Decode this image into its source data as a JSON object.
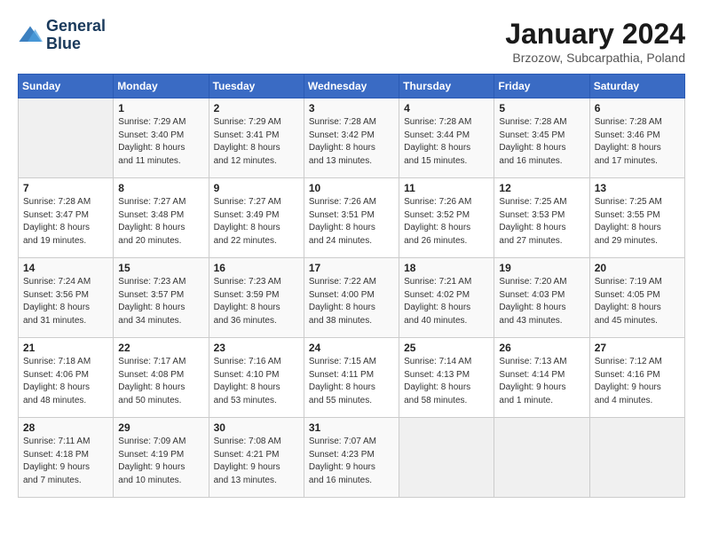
{
  "header": {
    "logo_line1": "General",
    "logo_line2": "Blue",
    "month_title": "January 2024",
    "subtitle": "Brzozow, Subcarpathia, Poland"
  },
  "weekdays": [
    "Sunday",
    "Monday",
    "Tuesday",
    "Wednesday",
    "Thursday",
    "Friday",
    "Saturday"
  ],
  "weeks": [
    [
      {
        "day": "",
        "info": ""
      },
      {
        "day": "1",
        "info": "Sunrise: 7:29 AM\nSunset: 3:40 PM\nDaylight: 8 hours\nand 11 minutes."
      },
      {
        "day": "2",
        "info": "Sunrise: 7:29 AM\nSunset: 3:41 PM\nDaylight: 8 hours\nand 12 minutes."
      },
      {
        "day": "3",
        "info": "Sunrise: 7:28 AM\nSunset: 3:42 PM\nDaylight: 8 hours\nand 13 minutes."
      },
      {
        "day": "4",
        "info": "Sunrise: 7:28 AM\nSunset: 3:44 PM\nDaylight: 8 hours\nand 15 minutes."
      },
      {
        "day": "5",
        "info": "Sunrise: 7:28 AM\nSunset: 3:45 PM\nDaylight: 8 hours\nand 16 minutes."
      },
      {
        "day": "6",
        "info": "Sunrise: 7:28 AM\nSunset: 3:46 PM\nDaylight: 8 hours\nand 17 minutes."
      }
    ],
    [
      {
        "day": "7",
        "info": "Sunrise: 7:28 AM\nSunset: 3:47 PM\nDaylight: 8 hours\nand 19 minutes."
      },
      {
        "day": "8",
        "info": "Sunrise: 7:27 AM\nSunset: 3:48 PM\nDaylight: 8 hours\nand 20 minutes."
      },
      {
        "day": "9",
        "info": "Sunrise: 7:27 AM\nSunset: 3:49 PM\nDaylight: 8 hours\nand 22 minutes."
      },
      {
        "day": "10",
        "info": "Sunrise: 7:26 AM\nSunset: 3:51 PM\nDaylight: 8 hours\nand 24 minutes."
      },
      {
        "day": "11",
        "info": "Sunrise: 7:26 AM\nSunset: 3:52 PM\nDaylight: 8 hours\nand 26 minutes."
      },
      {
        "day": "12",
        "info": "Sunrise: 7:25 AM\nSunset: 3:53 PM\nDaylight: 8 hours\nand 27 minutes."
      },
      {
        "day": "13",
        "info": "Sunrise: 7:25 AM\nSunset: 3:55 PM\nDaylight: 8 hours\nand 29 minutes."
      }
    ],
    [
      {
        "day": "14",
        "info": "Sunrise: 7:24 AM\nSunset: 3:56 PM\nDaylight: 8 hours\nand 31 minutes."
      },
      {
        "day": "15",
        "info": "Sunrise: 7:23 AM\nSunset: 3:57 PM\nDaylight: 8 hours\nand 34 minutes."
      },
      {
        "day": "16",
        "info": "Sunrise: 7:23 AM\nSunset: 3:59 PM\nDaylight: 8 hours\nand 36 minutes."
      },
      {
        "day": "17",
        "info": "Sunrise: 7:22 AM\nSunset: 4:00 PM\nDaylight: 8 hours\nand 38 minutes."
      },
      {
        "day": "18",
        "info": "Sunrise: 7:21 AM\nSunset: 4:02 PM\nDaylight: 8 hours\nand 40 minutes."
      },
      {
        "day": "19",
        "info": "Sunrise: 7:20 AM\nSunset: 4:03 PM\nDaylight: 8 hours\nand 43 minutes."
      },
      {
        "day": "20",
        "info": "Sunrise: 7:19 AM\nSunset: 4:05 PM\nDaylight: 8 hours\nand 45 minutes."
      }
    ],
    [
      {
        "day": "21",
        "info": "Sunrise: 7:18 AM\nSunset: 4:06 PM\nDaylight: 8 hours\nand 48 minutes."
      },
      {
        "day": "22",
        "info": "Sunrise: 7:17 AM\nSunset: 4:08 PM\nDaylight: 8 hours\nand 50 minutes."
      },
      {
        "day": "23",
        "info": "Sunrise: 7:16 AM\nSunset: 4:10 PM\nDaylight: 8 hours\nand 53 minutes."
      },
      {
        "day": "24",
        "info": "Sunrise: 7:15 AM\nSunset: 4:11 PM\nDaylight: 8 hours\nand 55 minutes."
      },
      {
        "day": "25",
        "info": "Sunrise: 7:14 AM\nSunset: 4:13 PM\nDaylight: 8 hours\nand 58 minutes."
      },
      {
        "day": "26",
        "info": "Sunrise: 7:13 AM\nSunset: 4:14 PM\nDaylight: 9 hours\nand 1 minute."
      },
      {
        "day": "27",
        "info": "Sunrise: 7:12 AM\nSunset: 4:16 PM\nDaylight: 9 hours\nand 4 minutes."
      }
    ],
    [
      {
        "day": "28",
        "info": "Sunrise: 7:11 AM\nSunset: 4:18 PM\nDaylight: 9 hours\nand 7 minutes."
      },
      {
        "day": "29",
        "info": "Sunrise: 7:09 AM\nSunset: 4:19 PM\nDaylight: 9 hours\nand 10 minutes."
      },
      {
        "day": "30",
        "info": "Sunrise: 7:08 AM\nSunset: 4:21 PM\nDaylight: 9 hours\nand 13 minutes."
      },
      {
        "day": "31",
        "info": "Sunrise: 7:07 AM\nSunset: 4:23 PM\nDaylight: 9 hours\nand 16 minutes."
      },
      {
        "day": "",
        "info": ""
      },
      {
        "day": "",
        "info": ""
      },
      {
        "day": "",
        "info": ""
      }
    ]
  ]
}
